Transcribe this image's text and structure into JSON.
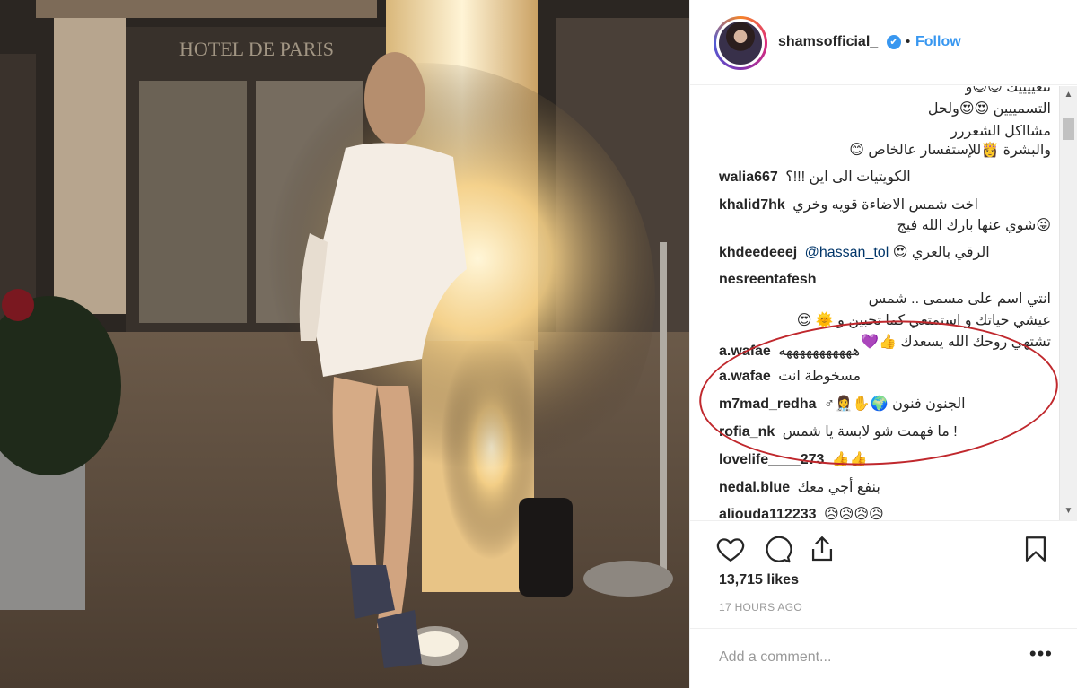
{
  "post": {
    "username": "shamsofficial_",
    "verified_mark": "✔",
    "separator": "•",
    "follow_label": "Follow",
    "photo_sign": "HOTEL DE PARIS"
  },
  "comments": [
    {
      "user": "",
      "text": "التسمييين 😍😍ولحل",
      "emojis": []
    },
    {
      "user": "",
      "text": "مشااكل الشعررر",
      "emojis": []
    },
    {
      "user": "",
      "text": "والبشرة 👸للإستفسار عالخاص 😊",
      "emojis": []
    },
    {
      "user": "walia667",
      "text": "الكويتيات الى اين !!!؟",
      "emojis": []
    },
    {
      "user": "khalid7hk",
      "text": "اخت شمس الاضاءة قويه وخري",
      "emojis": []
    },
    {
      "user": "",
      "text": "😜شوي عنها بارك الله فيج",
      "emojis": []
    },
    {
      "user": "khdeedeeej",
      "mention": "@hassan_tol",
      "text": "الرقي بالعري 😍",
      "emojis": []
    },
    {
      "user": "nesreentafesh",
      "text": "انتي اسم على مسمى .. شمس",
      "emojis": []
    },
    {
      "user": "",
      "text": "عيشي حياتك و استمتعي كما تحبين و 🌞 😍",
      "emojis": []
    },
    {
      "user": "",
      "text": "تشتهي روحك الله يسعدك 👍💜",
      "emojis": []
    },
    {
      "user": "a.wafae",
      "text": "هههههههههههه",
      "emojis": []
    },
    {
      "user": "a.wafae",
      "text": "مسخوطة انت",
      "emojis": []
    },
    {
      "user": "m7mad_redha",
      "text": "الجنون فنون 🌍✋👩‍⚕️♂",
      "emojis": []
    },
    {
      "user": "rofia_nk",
      "text": "! ما فهمت شو لابسة يا شمس",
      "emojis": []
    },
    {
      "user": "lovelife____273",
      "text": "👍👍",
      "emojis": []
    },
    {
      "user": "nedal.blue",
      "text": "بنفع أجي معك",
      "emojis": []
    },
    {
      "user": "aliouda112233",
      "text": "😥😥😥😥",
      "emojis": []
    }
  ],
  "actions": {
    "like_icon": "heart-icon",
    "comment_icon": "comment-icon",
    "share_icon": "share-icon",
    "save_icon": "bookmark-icon"
  },
  "likes_text": "13,715 likes",
  "timestamp": "17 HOURS AGO",
  "add_comment_placeholder": "Add a comment...",
  "more_label": "•••",
  "colors": {
    "link_blue": "#3897f0",
    "mention_blue": "#003569",
    "annotation_red": "#c0282d"
  }
}
